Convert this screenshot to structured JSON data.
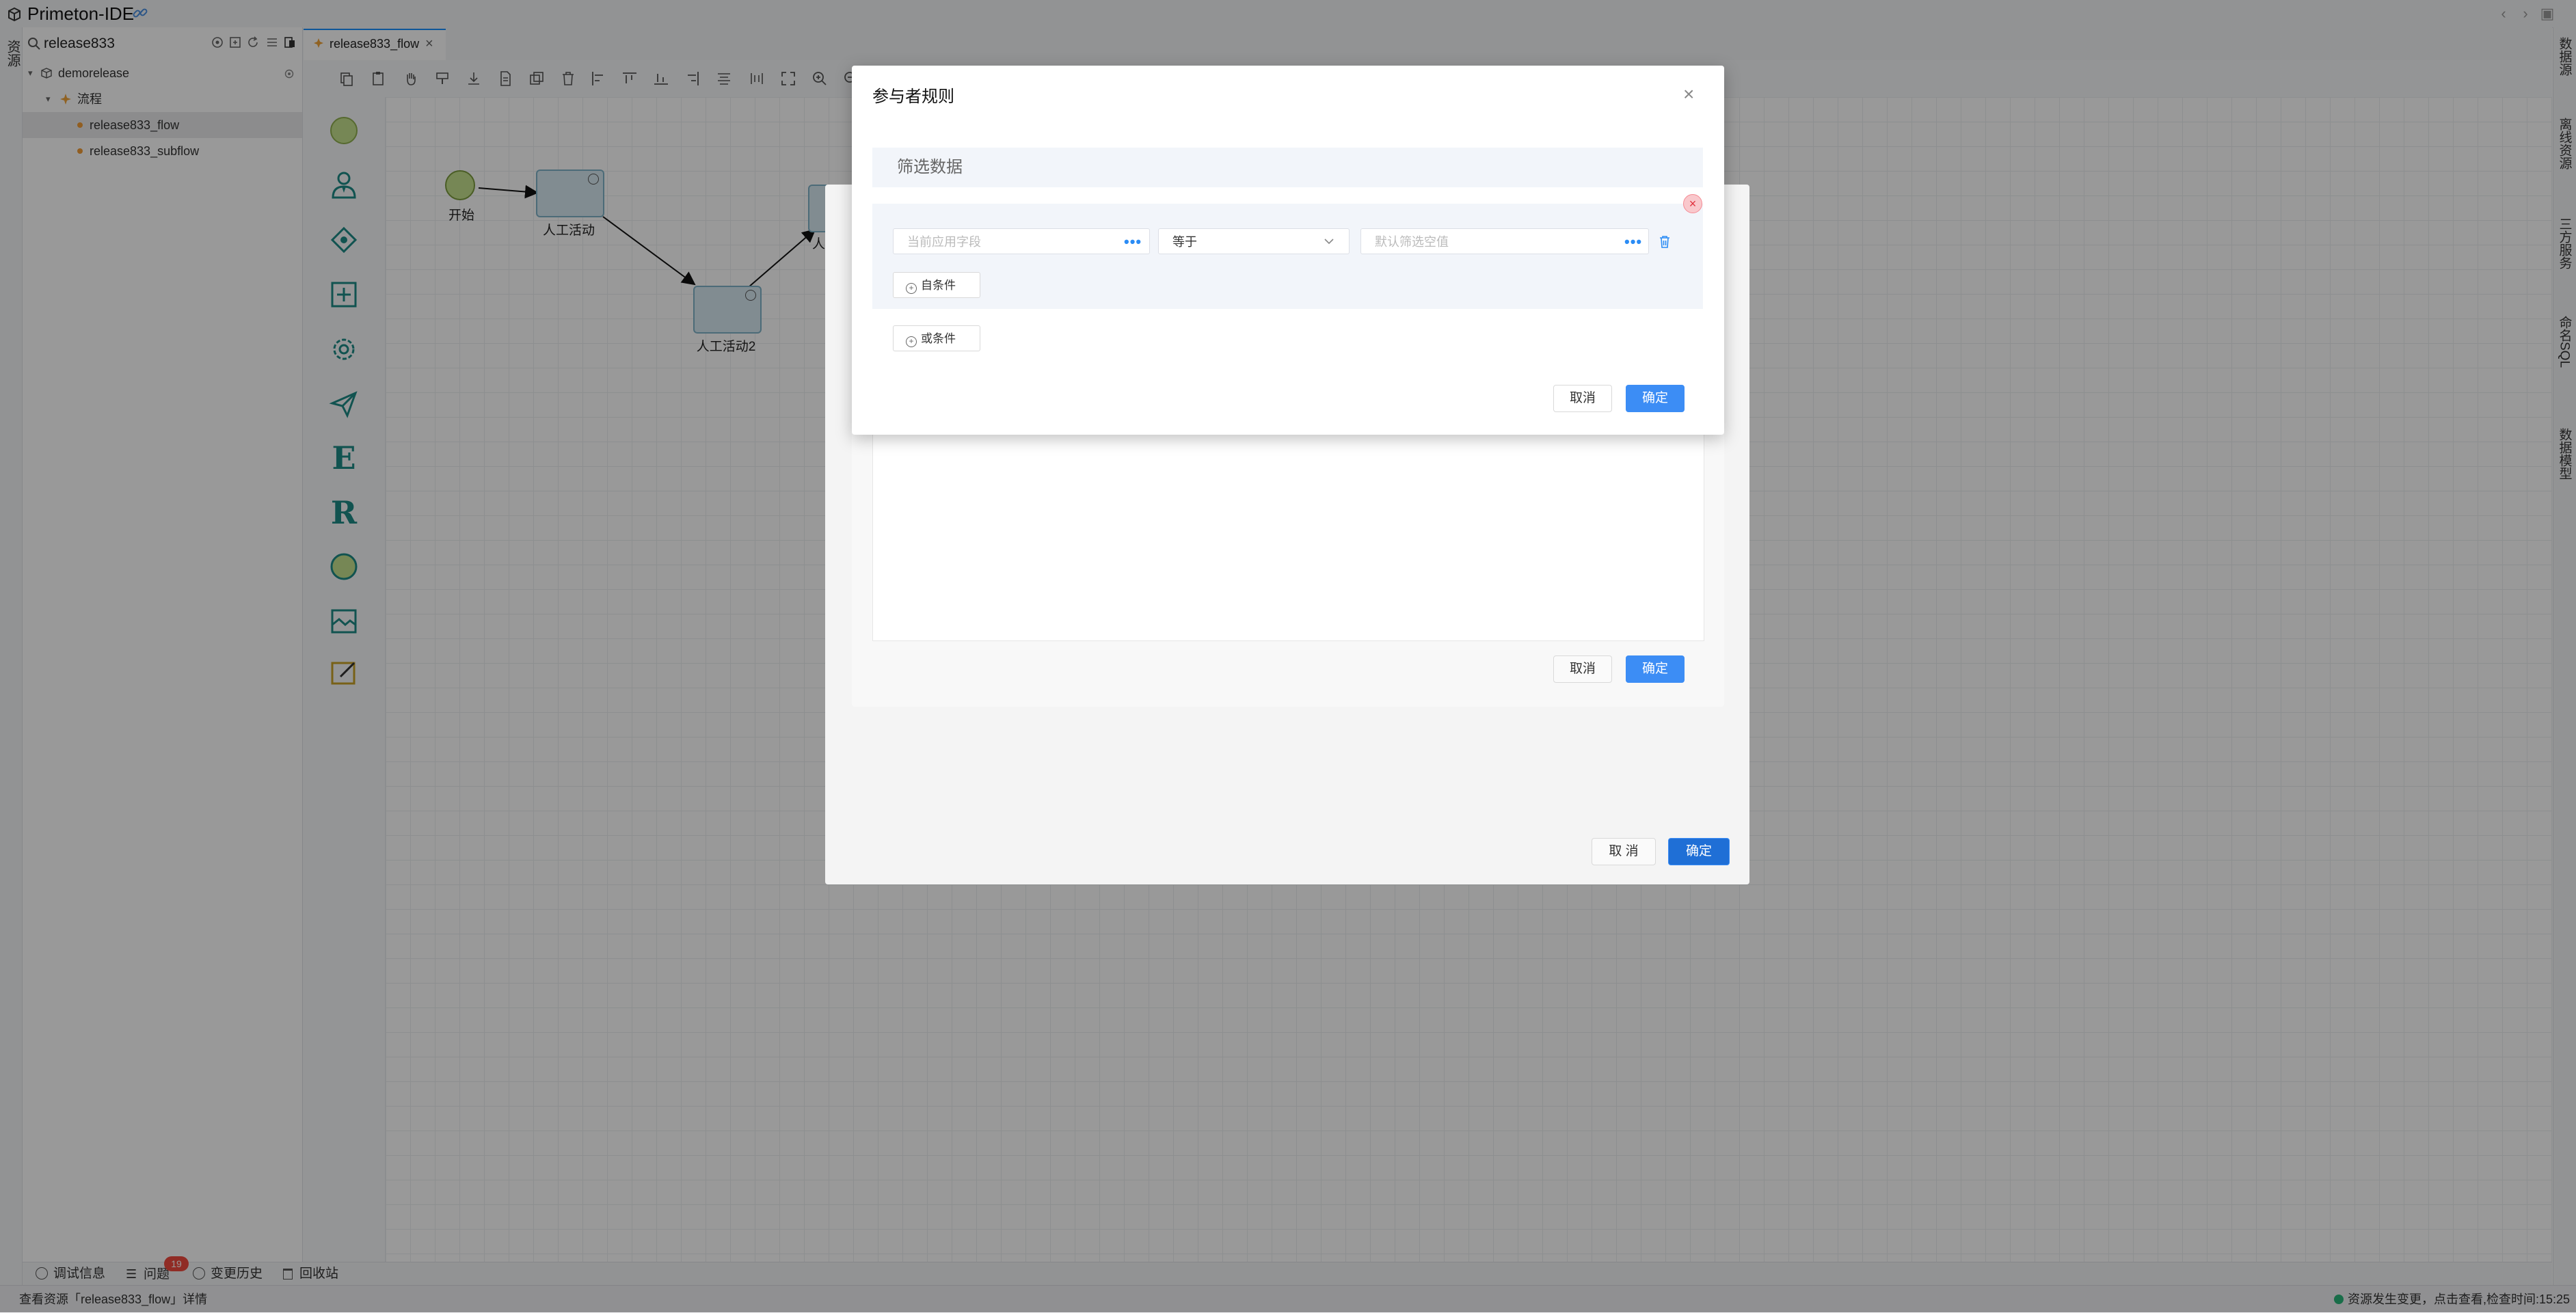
{
  "app": {
    "title": "Primeton-IDE",
    "left_strip_tab": "资源"
  },
  "sidebar": {
    "search_value": "release833",
    "tree": {
      "project": "demorelease",
      "folder": "流程",
      "items": [
        "release833_flow",
        "release833_subflow"
      ]
    }
  },
  "editor": {
    "tab_label": "release833_flow"
  },
  "diagram": {
    "start_label": "开始",
    "task1_label": "人工活动",
    "task2_label": "人工活动2",
    "task3_label_partial": "人"
  },
  "right_strip": {
    "tabs": [
      "数据源",
      "离线资源",
      "三方服务",
      "命名SQL",
      "数据模型"
    ]
  },
  "bottom_panels": {
    "items": [
      "调试信息",
      "问题",
      "变更历史",
      "回收站"
    ],
    "issues_count": "19"
  },
  "status_bar": {
    "left": "查看资源「release833_flow」详情",
    "right": "资源发生变更，点击查看,检查时间:15:25"
  },
  "dialog_back": {
    "cancel_label": "取 消",
    "ok_label": "确定"
  },
  "dialog_middle": {
    "cancel_label": "取消",
    "ok_label": "确定"
  },
  "dialog": {
    "title": "参与者规则",
    "filter_header": "筛选数据",
    "field_placeholder": "当前应用字段",
    "operator_value": "等于",
    "value_placeholder": "默认筛选空值",
    "sub_condition_label": "自条件",
    "or_condition_label": "或条件",
    "cancel_label": "取消",
    "ok_label": "确定"
  },
  "colors": {
    "primary": "#3c8df5",
    "danger": "#e0303c",
    "node_green": "#c5e28e",
    "palette_teal": "#1d8a86"
  },
  "icons": [
    "search-icon",
    "settings-icon",
    "refresh-icon",
    "close-icon",
    "chevron-down-icon",
    "trash-icon",
    "plus-circle-icon"
  ]
}
